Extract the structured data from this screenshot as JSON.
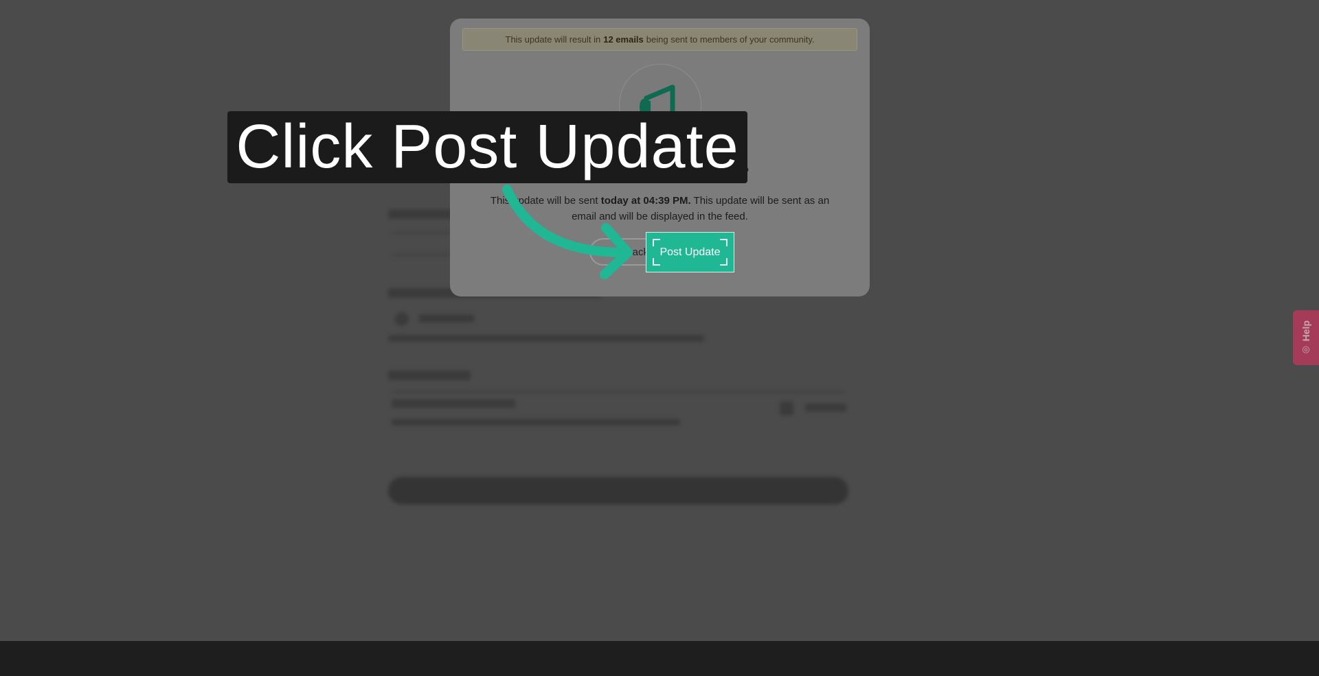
{
  "notice": {
    "before": "This update will result in",
    "bold": "12 emails",
    "after": "being sent to members of your community."
  },
  "modal": {
    "title": "Ready to Send Your Update?",
    "body_before": "This update will be sent",
    "body_bold": "today at 04:39 PM.",
    "body_after": "This update will be sent as an email and will be displayed in the feed.",
    "back_label": "Back",
    "post_label": "Post Update",
    "icon": "megaphone-icon"
  },
  "tooltip": {
    "text": "Click Post Update"
  },
  "help": {
    "label": "Help",
    "icon": "lifebuoy-icon"
  },
  "colors": {
    "accent": "#1fb794",
    "help": "#c2375e",
    "arrow": "#1fb794"
  }
}
